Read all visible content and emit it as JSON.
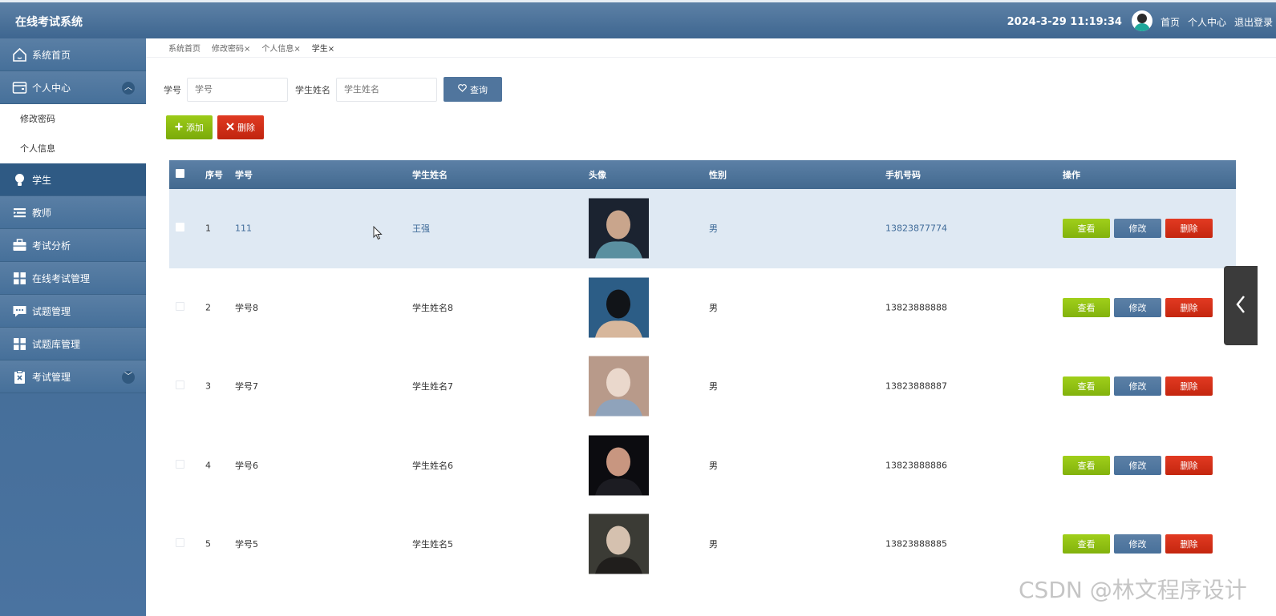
{
  "app": {
    "title": "在线考试系统",
    "datetime": "2024-3-29 11:19:34",
    "nav_home": "首页",
    "nav_profile": "个人中心",
    "nav_logout": "退出登录"
  },
  "sidebar": {
    "items": [
      {
        "label": "系统首页",
        "icon": "home-icon"
      },
      {
        "label": "个人中心",
        "icon": "wallet-icon",
        "expanded": true
      },
      {
        "label": "学生",
        "icon": "lightbulb-icon",
        "active": true
      },
      {
        "label": "教师",
        "icon": "list-icon"
      },
      {
        "label": "考试分析",
        "icon": "briefcase-icon"
      },
      {
        "label": "在线考试管理",
        "icon": "grid-icon"
      },
      {
        "label": "试题管理",
        "icon": "comment-icon"
      },
      {
        "label": "试题库管理",
        "icon": "grid-icon"
      },
      {
        "label": "考试管理",
        "icon": "clipboard-icon"
      }
    ],
    "submenu": [
      "修改密码",
      "个人信息"
    ]
  },
  "tabs": [
    {
      "label": "系统首页"
    },
    {
      "label": "修改密码",
      "close": "×"
    },
    {
      "label": "个人信息",
      "close": "×"
    },
    {
      "label": "学生",
      "close": "×"
    }
  ],
  "search": {
    "student_no_label": "学号",
    "student_no_placeholder": "学号",
    "student_name_label": "学生姓名",
    "student_name_placeholder": "学生姓名",
    "query_label": "查询"
  },
  "toolbar": {
    "add_label": "添加",
    "delete_label": "删除"
  },
  "table": {
    "headers": {
      "index": "序号",
      "student_no": "学号",
      "name": "学生姓名",
      "avatar": "头像",
      "gender": "性别",
      "phone": "手机号码",
      "ops": "操作"
    },
    "rows": [
      {
        "index": "1",
        "student_no": "111",
        "name": "王强",
        "gender": "男",
        "phone": "13823877774",
        "photo_colors": [
          "#1b2330",
          "#c9a58c",
          "#5a8fa0"
        ]
      },
      {
        "index": "2",
        "student_no": "学号8",
        "name": "学生姓名8",
        "gender": "男",
        "phone": "13823888888",
        "photo_colors": [
          "#2c5d86",
          "#111418",
          "#d7b79c"
        ]
      },
      {
        "index": "3",
        "student_no": "学号7",
        "name": "学生姓名7",
        "gender": "男",
        "phone": "13823888887",
        "photo_colors": [
          "#b89a8a",
          "#ead8cc",
          "#8fa3bb"
        ]
      },
      {
        "index": "4",
        "student_no": "学号6",
        "name": "学生姓名6",
        "gender": "男",
        "phone": "13823888886",
        "photo_colors": [
          "#0c0c10",
          "#c89680",
          "#1c1c22"
        ]
      },
      {
        "index": "5",
        "student_no": "学号5",
        "name": "学生姓名5",
        "gender": "男",
        "phone": "13823888885",
        "photo_colors": [
          "#3b3b35",
          "#d5c1af",
          "#201e1c"
        ]
      }
    ],
    "op_view": "查看",
    "op_edit": "修改",
    "op_delete": "删除"
  },
  "watermark": "CSDN @林文程序设计"
}
